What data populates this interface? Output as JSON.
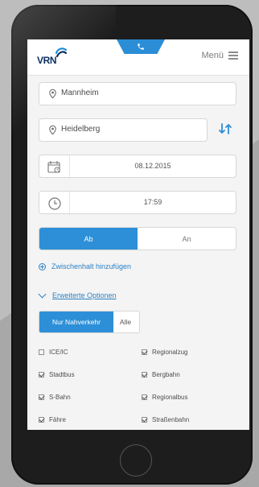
{
  "header": {
    "logo_text": "VRN",
    "menu_label": "Menü"
  },
  "trip": {
    "from": "Mannheim",
    "to": "Heidelberg",
    "date": "08.12.2015",
    "time": "17:59",
    "mode_left": "Ab",
    "mode_right": "An",
    "add_intermediate": "Zwischenhalt hinzufügen",
    "extended_options": "Erweiterte Optionen",
    "filter_left": "Nur Nahverkehr",
    "filter_right": "Alle"
  },
  "transport_options": [
    {
      "label": "ICE/IC",
      "checked": false
    },
    {
      "label": "Regionalzug",
      "checked": true
    },
    {
      "label": "Stadtbus",
      "checked": true
    },
    {
      "label": "Bergbahn",
      "checked": true
    },
    {
      "label": "S-Bahn",
      "checked": true
    },
    {
      "label": "Regionalbus",
      "checked": true
    },
    {
      "label": "Fähre",
      "checked": true
    },
    {
      "label": "Straßenbahn",
      "checked": true
    }
  ],
  "colors": {
    "accent": "#2d8fd7",
    "background": "#f4f4f4",
    "logo": "#0d2f65"
  },
  "icons": {
    "phone": "phone-icon",
    "menu": "hamburger-menu-icon",
    "location": "map-pin-icon",
    "swap": "swap-arrows-icon",
    "calendar": "calendar-icon",
    "clock": "clock-icon",
    "add": "circle-plus-icon",
    "chevron": "chevron-down-icon"
  }
}
